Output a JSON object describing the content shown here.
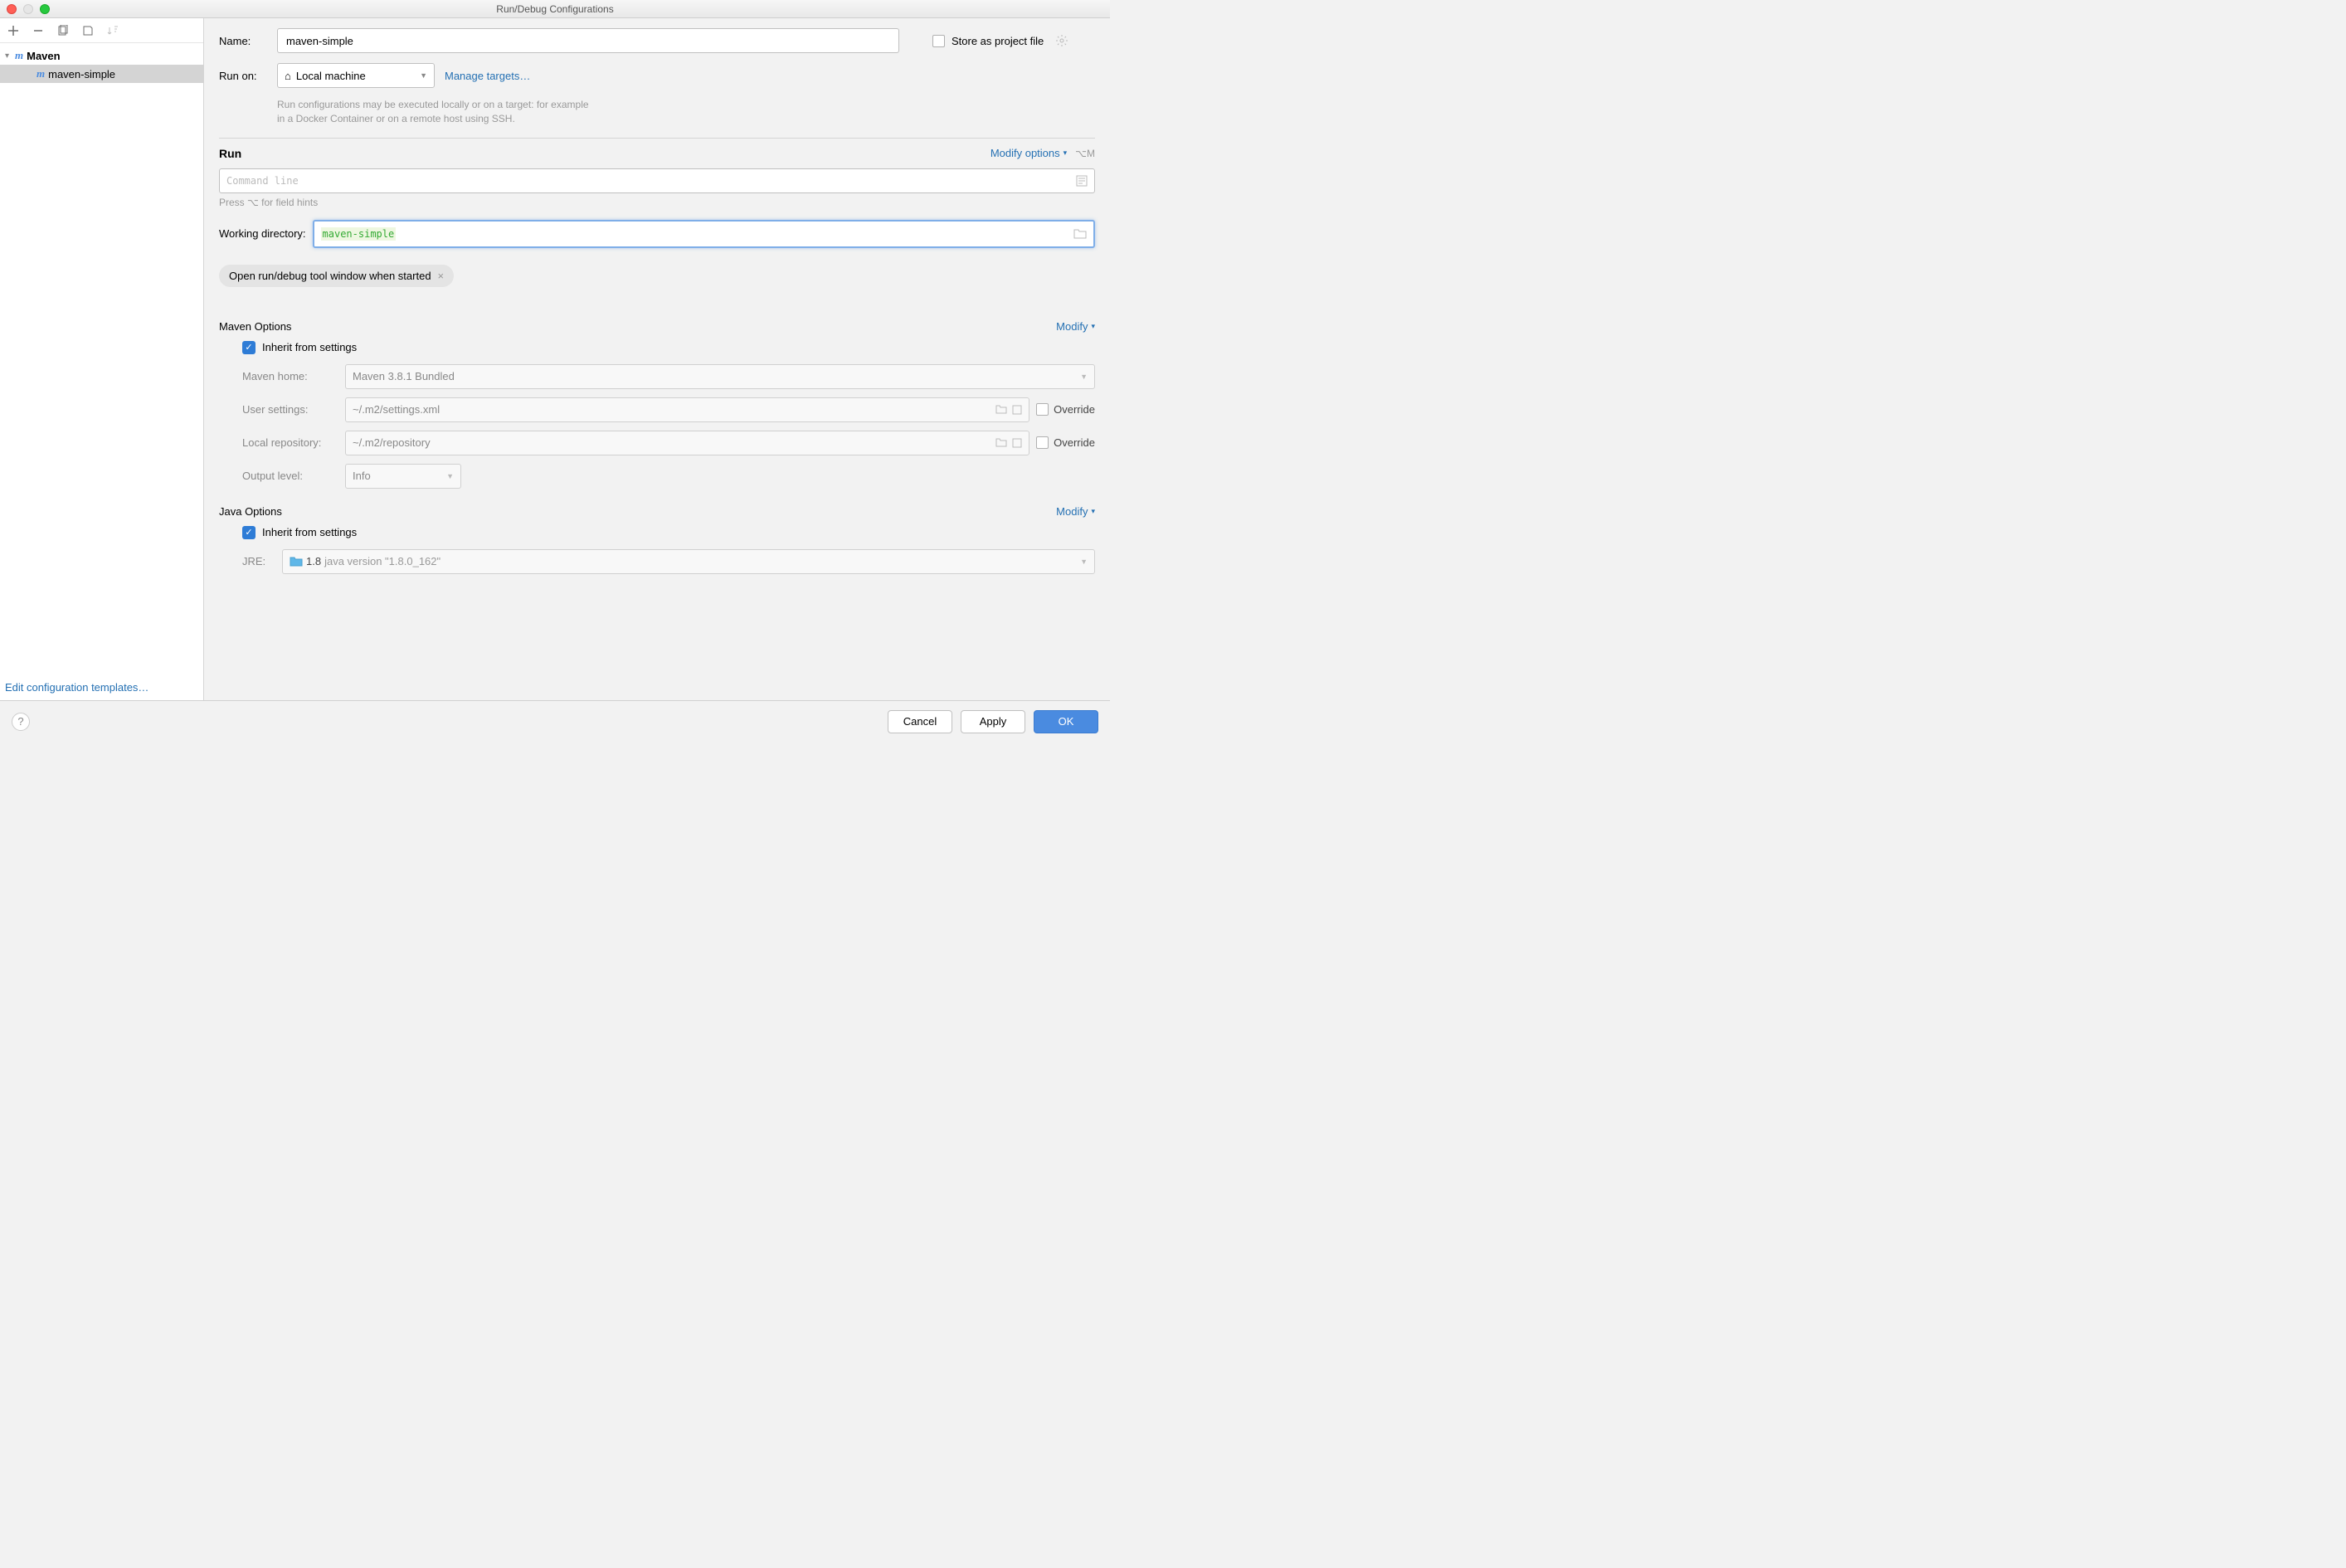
{
  "window": {
    "title": "Run/Debug Configurations"
  },
  "sidebar": {
    "root_label": "Maven",
    "item_label": "maven-simple",
    "edit_templates": "Edit configuration templates…"
  },
  "form": {
    "name_label": "Name:",
    "name_value": "maven-simple",
    "store_label": "Store as project file",
    "run_on_label": "Run on:",
    "run_on_value": "Local machine",
    "manage_targets": "Manage targets…",
    "run_on_hint1": "Run configurations may be executed locally or on a target: for example",
    "run_on_hint2": "in a Docker Container or on a remote host using SSH."
  },
  "run": {
    "title": "Run",
    "modify": "Modify options",
    "shortcut": "⌥M",
    "cmd_placeholder": "Command line",
    "cmd_hint": "Press ⌥ for field hints",
    "wd_label": "Working directory:",
    "wd_value": "maven-simple",
    "tag": "Open run/debug tool window when started"
  },
  "maven": {
    "title": "Maven Options",
    "modify": "Modify",
    "inherit": "Inherit from settings",
    "home_label": "Maven home:",
    "home_value": "Maven 3.8.1 Bundled",
    "user_label": "User settings:",
    "user_value": "~/.m2/settings.xml",
    "repo_label": "Local repository:",
    "repo_value": "~/.m2/repository",
    "output_label": "Output level:",
    "output_value": "Info",
    "override": "Override"
  },
  "java": {
    "title": "Java Options",
    "modify": "Modify",
    "inherit": "Inherit from settings",
    "jre_label": "JRE:",
    "jre_value": "1.8",
    "jre_sub": "java version \"1.8.0_162\""
  },
  "footer": {
    "cancel": "Cancel",
    "apply": "Apply",
    "ok": "OK"
  }
}
